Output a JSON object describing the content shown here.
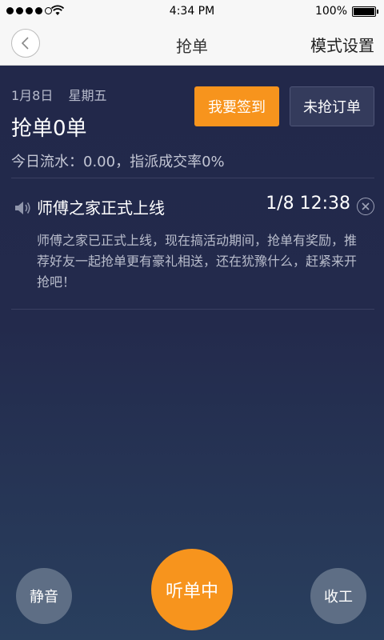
{
  "status_bar": {
    "time": "4:34 PM",
    "battery": "100%"
  },
  "nav": {
    "title": "抢单",
    "mode_settings": "模式设置"
  },
  "header": {
    "date": "1月8日",
    "weekday": "星期五",
    "grab_count": "抢单0单",
    "today_stats": "今日流水：0.00，指派成交率0%",
    "checkin_label": "我要签到",
    "ungrabbed_label": "未抢订单"
  },
  "notice": {
    "title": "师傅之家正式上线",
    "time": "1/8 12:38",
    "body": "师傅之家已正式上线，现在搞活动期间，抢单有奖励，推荐好友一起抢单更有豪礼相送，还在犹豫什么，赶紧来开抢吧！"
  },
  "bottom": {
    "mute_label": "静音",
    "listen_label": "听单中",
    "finish_label": "收工"
  },
  "colors": {
    "accent": "#f7941d",
    "background_dark": "#22284a",
    "button_gray": "#5e6e85"
  },
  "icons": {
    "back": "chevron-left-icon",
    "notice": "speaker-icon",
    "close": "close-circle-icon",
    "wifi": "wifi-icon",
    "battery": "battery-icon"
  }
}
